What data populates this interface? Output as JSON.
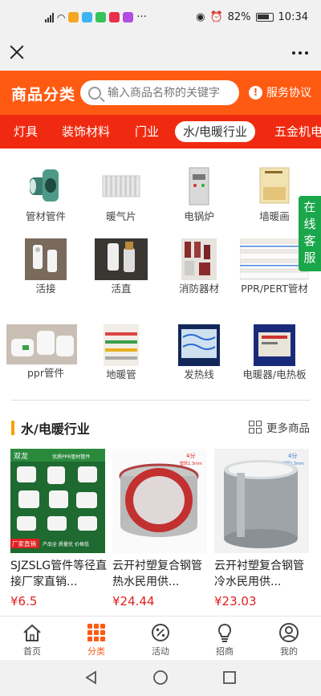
{
  "status": {
    "battery": "82%",
    "time": "10:34"
  },
  "header": {
    "logo": "商品分类",
    "search_placeholder": "输入商品名称的关键字",
    "service": "服务协议"
  },
  "tabs": [
    "灯具",
    "装饰材料",
    "门业",
    "水/电暖行业",
    "五金机电"
  ],
  "active_tab": "水/电暖行业",
  "categories": [
    "管材管件",
    "暖气片",
    "电锅炉",
    "墙暖画",
    "活接",
    "活直",
    "消防器材",
    "PPR/PERT管材",
    "ppr管件",
    "地暖管",
    "发热线",
    "电暖器/电热板"
  ],
  "float_service": "在线客服",
  "section": {
    "title": "水/电暖行业",
    "more": "更多商品"
  },
  "products": [
    {
      "name": "SJZSLG管件等径直接厂家直销...",
      "price": "¥6.5",
      "tag": "",
      "sub": "",
      "brand": "双龙",
      "brand_line": "优质PPR管材管件",
      "badge": "厂家直销",
      "badge2": "产品全 质量优 价格低"
    },
    {
      "name": "云开衬塑复合钢管热水民用供...",
      "price": "¥24.44",
      "tag": "4分",
      "sub": "壁厚2.3mm"
    },
    {
      "name": "云开衬塑复合钢管冷水民用供...",
      "price": "¥23.03",
      "tag": "4分",
      "sub": "壁厚2.3mm"
    }
  ],
  "nav": [
    {
      "label": "首页",
      "icon": "home-icon"
    },
    {
      "label": "分类",
      "icon": "category-icon"
    },
    {
      "label": "活动",
      "icon": "percent-icon"
    },
    {
      "label": "招商",
      "icon": "bulb-icon"
    },
    {
      "label": "我的",
      "icon": "user-icon"
    }
  ],
  "colors": {
    "brand": "#ff5a12",
    "tabbar": "#f02a10",
    "price": "#e02020",
    "service": "#1aa64a"
  }
}
